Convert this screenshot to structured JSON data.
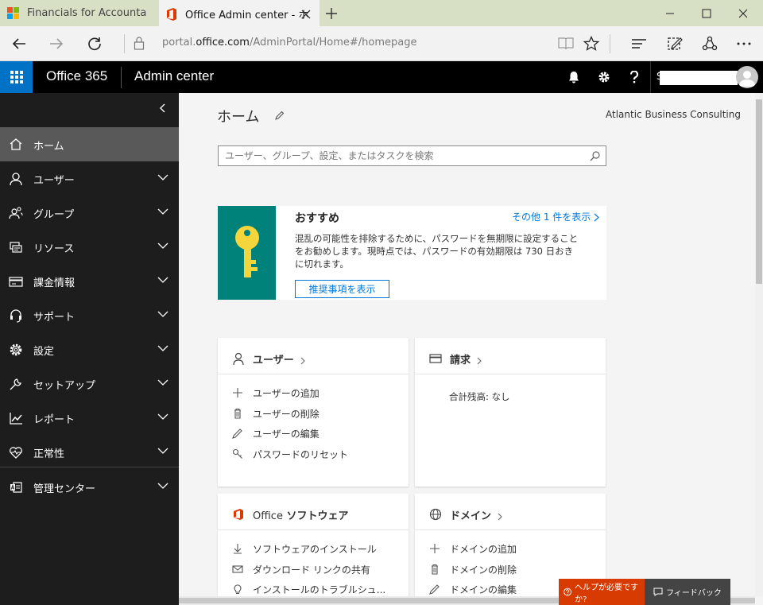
{
  "browser": {
    "tabs": [
      {
        "title": "Financials for Accountants—",
        "active": false
      },
      {
        "title": "Office Admin center - ホ",
        "active": true
      }
    ],
    "url_prefix": "portal.",
    "url_domain": "office.com",
    "url_path": "/AdminPortal/Home#/homepage"
  },
  "header": {
    "brand": "Office 365",
    "app_name": "Admin center",
    "user_initial": "S",
    "accent_color": "#0072c6"
  },
  "sidebar": {
    "items": [
      {
        "label": "ホーム",
        "icon": "home-icon",
        "active": true,
        "expandable": false
      },
      {
        "label": "ユーザー",
        "icon": "user-icon",
        "active": false,
        "expandable": true
      },
      {
        "label": "グループ",
        "icon": "group-icon",
        "active": false,
        "expandable": true
      },
      {
        "label": "リソース",
        "icon": "resources-icon",
        "active": false,
        "expandable": true
      },
      {
        "label": "課金情報",
        "icon": "billing-icon",
        "active": false,
        "expandable": true
      },
      {
        "label": "サポート",
        "icon": "support-icon",
        "active": false,
        "expandable": true
      },
      {
        "label": "設定",
        "icon": "settings-icon",
        "active": false,
        "expandable": true
      },
      {
        "label": "セットアップ",
        "icon": "wrench-icon",
        "active": false,
        "expandable": true
      },
      {
        "label": "レポート",
        "icon": "chart-icon",
        "active": false,
        "expandable": true
      },
      {
        "label": "正常性",
        "icon": "heart-icon",
        "active": false,
        "expandable": true
      },
      {
        "label": "管理センター",
        "icon": "admin-center-icon",
        "active": false,
        "expandable": true
      }
    ]
  },
  "main": {
    "page_title": "ホーム",
    "org_name": "Atlantic Business Consulting",
    "search_placeholder": "ユーザー、グループ、設定、またはタスクを検索",
    "recommendation": {
      "title": "おすすめ",
      "more_link": "その他 1 件を表示",
      "text": "混乱の可能性を排除するために、パスワードを無期限に設定することをお勧めします。現時点では、パスワードの有効期限は 730 日おきに切れます。",
      "button": "推奨事項を表示",
      "tile_color": "#00827a"
    },
    "cards": {
      "users": {
        "title": "ユーザー",
        "links": [
          "ユーザーの追加",
          "ユーザーの削除",
          "ユーザーの編集",
          "パスワードのリセット"
        ]
      },
      "billing": {
        "title": "請求",
        "balance": "合計残高: なし"
      },
      "office": {
        "title_prefix": "Office",
        "title_suffix": "ソフトウェア",
        "links": [
          "ソフトウェアのインストール",
          "ダウンロード リンクの共有",
          "インストールのトラブルシュ..."
        ]
      },
      "domains": {
        "title": "ドメイン",
        "links": [
          "ドメインの追加",
          "ドメインの削除",
          "ドメインの編集"
        ]
      }
    }
  },
  "footer": {
    "help": "ヘルプが必要ですか?",
    "feedback": "フィードバック"
  }
}
